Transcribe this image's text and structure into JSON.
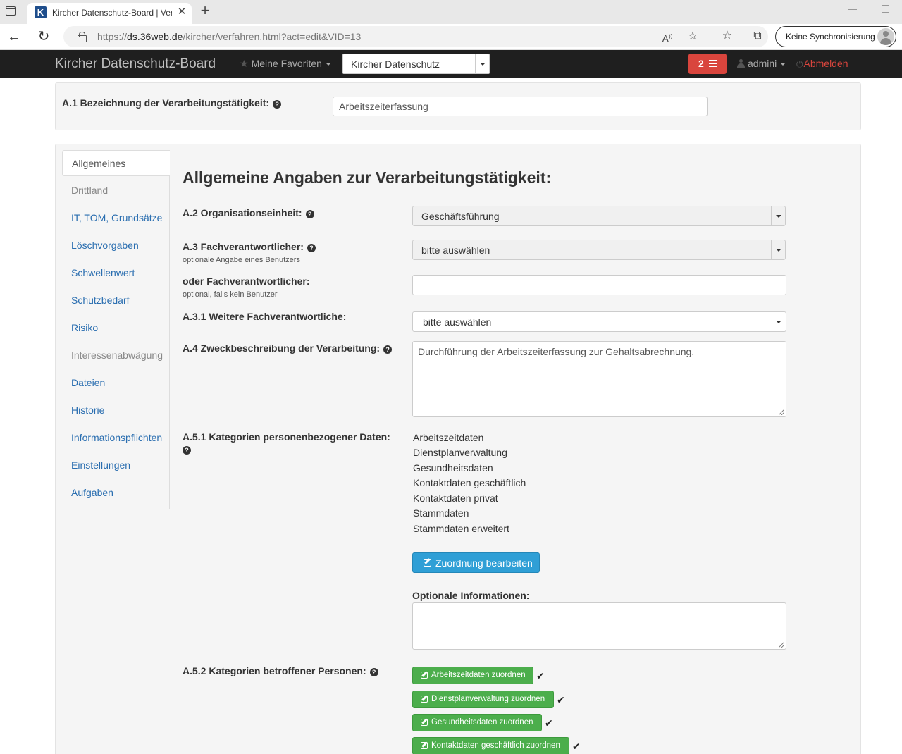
{
  "browser": {
    "tab_title": "Kircher Datenschutz-Board | Verarbeitungstätigkeit",
    "favicon_letter": "K",
    "url_prefix": "https://",
    "url_host": "ds.36web.de",
    "url_path": "/kircher/verfahren.html?act=edit&VID=13",
    "sync_label": "Keine Synchronisierung"
  },
  "navbar": {
    "brand": "Kircher Datenschutz-Board",
    "favorites_label": "Meine Favoriten",
    "tenant_select": "Kircher Datenschutz",
    "task_count": "2",
    "user_label": "admini",
    "logout_label": "Abmelden",
    "colors": {
      "background": "#1f1f1f",
      "badge": "#d9453d",
      "logout": "#d9453d"
    }
  },
  "header_form": {
    "label": "A.1 Bezeichnung der Verarbeitungstätigkeit:",
    "value": "Arbeitszeiterfassung"
  },
  "sidebar": {
    "items": [
      {
        "label": "Allgemeines",
        "state": "active"
      },
      {
        "label": "Drittland",
        "state": "disabled"
      },
      {
        "label": "IT, TOM, Grundsätze",
        "state": "link"
      },
      {
        "label": "Löschvorgaben",
        "state": "link"
      },
      {
        "label": "Schwellenwert",
        "state": "link"
      },
      {
        "label": "Schutzbedarf",
        "state": "link"
      },
      {
        "label": "Risiko",
        "state": "link"
      },
      {
        "label": "Interessenabwägung",
        "state": "disabled"
      },
      {
        "label": "Dateien",
        "state": "link"
      },
      {
        "label": "Historie",
        "state": "link"
      },
      {
        "label": "Informationspflichten",
        "state": "link"
      },
      {
        "label": "Einstellungen",
        "state": "link"
      },
      {
        "label": "Aufgaben",
        "state": "link"
      }
    ]
  },
  "main": {
    "title": "Allgemeine Angaben zur Verarbeitungstätigkeit:",
    "org_unit": {
      "label": "A.2 Organisationseinheit:",
      "value": "Geschäftsführung"
    },
    "responsible": {
      "label": "A.3 Fachverantwortlicher:",
      "hint": "optionale Angabe eines Benutzers",
      "value": "bitte auswählen"
    },
    "responsible_alt": {
      "label": "oder Fachverantwortlicher:",
      "hint": "optional, falls kein Benutzer",
      "value": ""
    },
    "further_responsible": {
      "label": "A.3.1 Weitere Fachverantwortliche:",
      "value": "bitte auswählen"
    },
    "purpose": {
      "label": "A.4 Zweckbeschreibung der Verarbeitung:",
      "value": "Durchführung der Arbeitszeiterfassung zur Gehaltsabrechnung."
    },
    "data_categories": {
      "label": "A.5.1 Kategorien personenbezogener Daten:",
      "items": [
        "Arbeitszeitdaten",
        "Dienstplanverwaltung",
        "Gesundheitsdaten",
        "Kontaktdaten geschäftlich",
        "Kontaktdaten privat",
        "Stammdaten",
        "Stammdaten erweitert"
      ],
      "edit_button": "Zuordnung bearbeiten"
    },
    "optional_info": {
      "label": "Optionale Informationen:",
      "value": ""
    },
    "persons": {
      "label": "A.5.2 Kategorien betroffener Personen:",
      "buttons": [
        "Arbeitszeitdaten zuordnen",
        "Dienstplanverwaltung zuordnen",
        "Gesundheitsdaten zuordnen",
        "Kontaktdaten geschäftlich zuordnen"
      ]
    },
    "colors": {
      "link": "#2a6eb0",
      "info_button": "#2f9fd6",
      "success_button": "#4cae4c"
    }
  }
}
